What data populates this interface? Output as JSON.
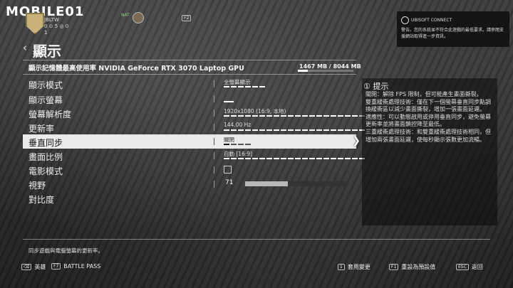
{
  "watermark": "MOBILE01",
  "player": {
    "name": "JBLTW",
    "stats": "0 ⊙ 5 ◎ 0",
    "level": "1",
    "nat": "NAT"
  },
  "keys": {
    "f2": "F2"
  },
  "ubisoft": {
    "title": "UBISOFT CONNECT",
    "message": "警告。您的系統並不符合此遊戲的最低要求。請參閱支援網站取得進一步資訊。"
  },
  "header": {
    "icon": "‹",
    "title": "顯示"
  },
  "vram": {
    "label": "顯示記憶體最高使用率 NVIDIA GeForce RTX 3070 Laptop GPU",
    "value": "1467 MB / 8044 MB",
    "fraction": 0.18
  },
  "settings": [
    {
      "label": "顯示模式",
      "value": "全螢幕顯示"
    },
    {
      "label": "顯示螢幕",
      "value": ""
    },
    {
      "label": "螢幕解析度",
      "value": "1920x1080 (16:9, 本地)"
    },
    {
      "label": "更新率",
      "value": "144.00 Hz"
    },
    {
      "label": "垂直同步",
      "value": "關閉"
    },
    {
      "label": "畫面比例",
      "value": "自動 [16:9]"
    },
    {
      "label": "電影模式",
      "value": ""
    },
    {
      "label": "視野",
      "value": "71",
      "fraction": 0.42
    },
    {
      "label": "對比度",
      "value": ""
    }
  ],
  "tips": {
    "icon": "①",
    "title": "提示",
    "lines": [
      "關閉：解除 FPS 限制，但可能產生畫面撕裂。",
      "雙重緩衝處理技術：僅在下一個螢幕垂直同步點調換緩衝區以減少畫面撕裂，增加一張畫面延遲。",
      "適應性：可以動態啟用或停用垂直同步，避免螢幕更新率並將畫面鎖控降至最低。",
      "三重緩衝處理技術：和雙重緩衝處理技術相同，但增加兩張畫面延遲，使每秒顯示張數更加流暢。"
    ]
  },
  "description": "同步遊戲與電腦螢幕的更新率。",
  "footer": {
    "heroes": {
      "key": "⌫",
      "label": "英雄"
    },
    "battlepass": {
      "key": "F7",
      "label": "BATTLE PASS"
    },
    "apply": {
      "key": "1",
      "label": "套用變更"
    },
    "reset": {
      "key": "F1",
      "label": "重設為預設值"
    },
    "back": {
      "key": "ESC",
      "label": "返回"
    }
  }
}
